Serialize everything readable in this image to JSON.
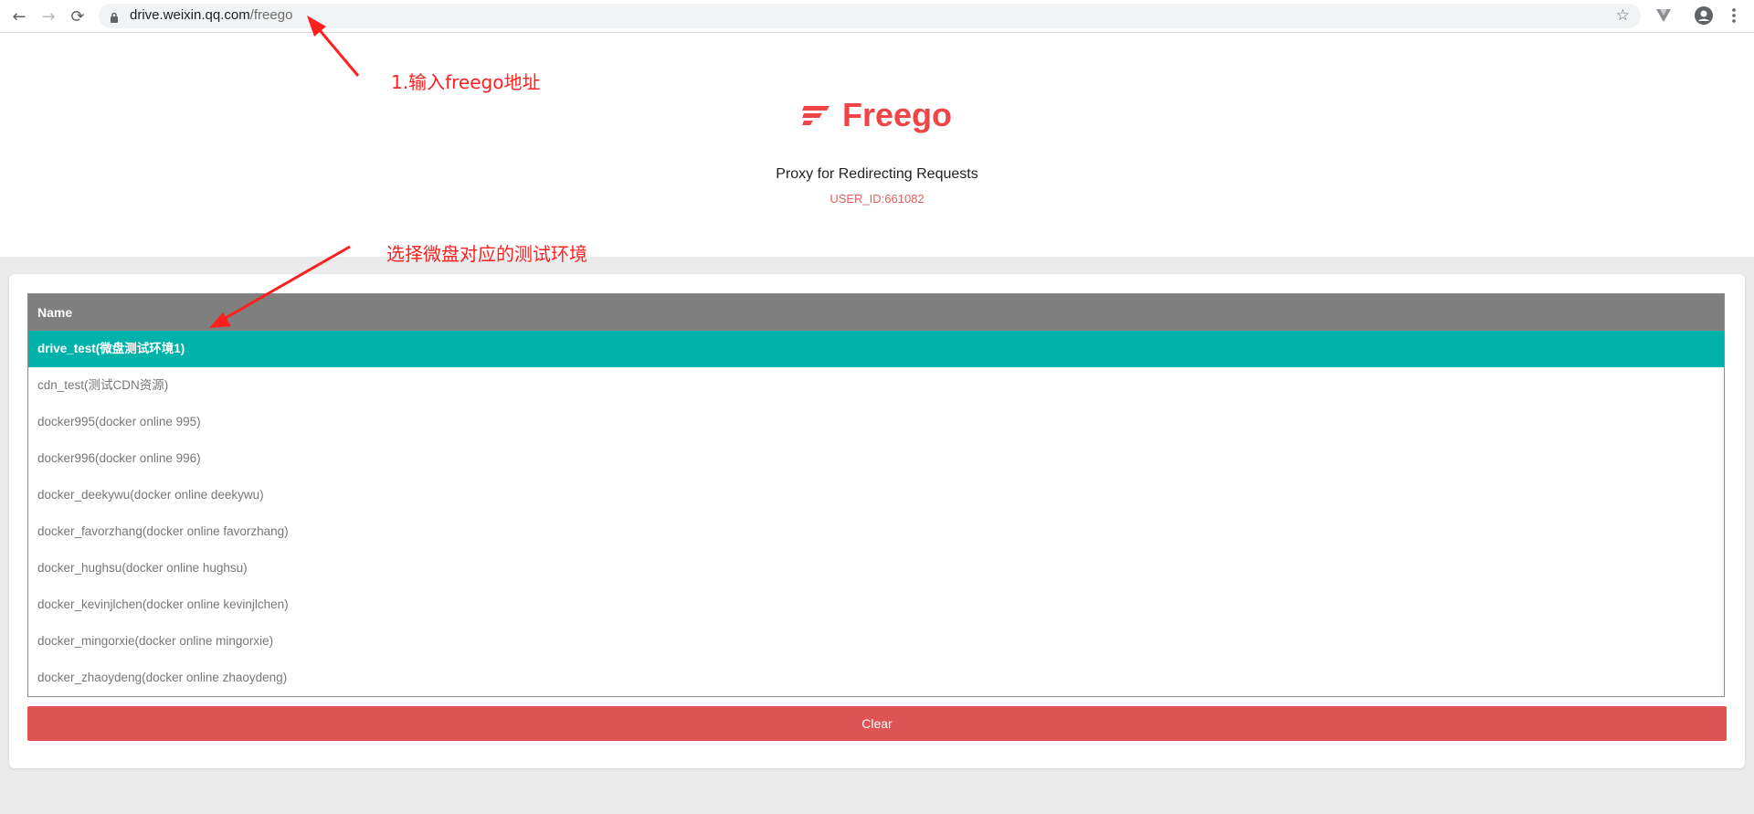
{
  "browser": {
    "url_host": "drive.weixin.qq.com",
    "url_path": "/freego"
  },
  "app": {
    "logo_text": "Freego",
    "subtitle": "Proxy for Redirecting Requests",
    "user_id": "USER_ID:661082",
    "brand_color": "#ee4547"
  },
  "table": {
    "header": "Name",
    "rows": [
      "drive_test(微盘测试环境1)",
      "cdn_test(测试CDN资源)",
      "docker995(docker online 995)",
      "docker996(docker online 996)",
      "docker_deekywu(docker online deekywu)",
      "docker_favorzhang(docker online favorzhang)",
      "docker_hughsu(docker online hughsu)",
      "docker_kevinjlchen(docker online kevinjlchen)",
      "docker_mingorxie(docker online mingorxie)",
      "docker_zhaoydeng(docker online zhaoydeng)"
    ],
    "selected_index": 0,
    "selected_color": "#00b2aa"
  },
  "actions": {
    "clear_label": "Clear",
    "clear_color": "#de5353"
  },
  "annotations": {
    "step1": "1.输入freego地址",
    "step2": "选择微盘对应的测试环境",
    "color": "#ff1f1f"
  }
}
